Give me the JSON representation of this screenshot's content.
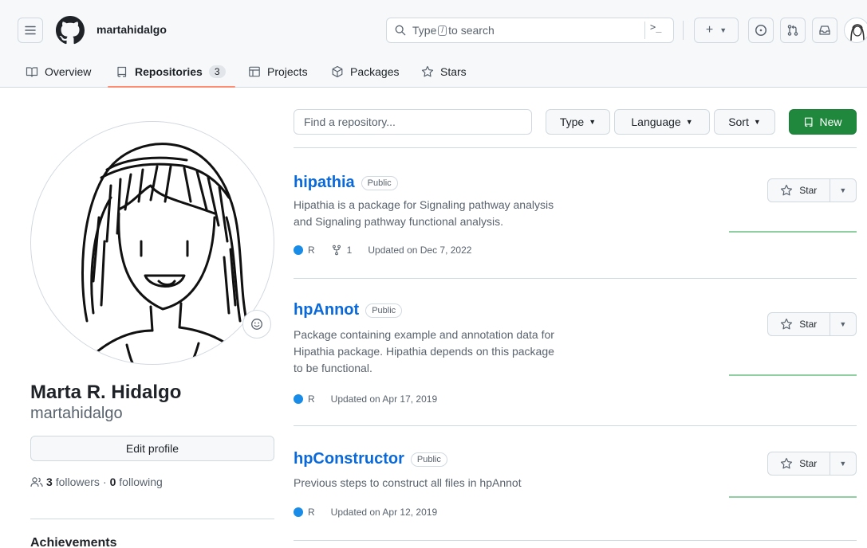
{
  "header": {
    "username": "martahidalgo",
    "search": {
      "prefix": "Type",
      "slash_key": "/",
      "suffix": "to search"
    },
    "command_symbol": ">_",
    "plus_symbol": "+"
  },
  "tabs": [
    {
      "label": "Overview",
      "icon": "book-icon"
    },
    {
      "label": "Repositories",
      "icon": "repo-icon",
      "count": "3",
      "active": true
    },
    {
      "label": "Projects",
      "icon": "table-icon"
    },
    {
      "label": "Packages",
      "icon": "package-icon"
    },
    {
      "label": "Stars",
      "icon": "star-icon"
    }
  ],
  "profile": {
    "full_name": "Marta R. Hidalgo",
    "login": "martahidalgo",
    "edit_profile_label": "Edit profile",
    "followers_count": "3",
    "followers_label": "followers",
    "dot_separator": "·",
    "following_count": "0",
    "following_label": "following",
    "achievements_label": "Achievements"
  },
  "repo_filters": {
    "find_placeholder": "Find a repository...",
    "type_label": "Type",
    "language_label": "Language",
    "sort_label": "Sort",
    "new_label": "New"
  },
  "repos": [
    {
      "name": "hipathia",
      "visibility": "Public",
      "description_lines": [
        "Hipathia is a package for Signaling pathway analysis",
        "and Signaling pathway functional analysis."
      ],
      "language": "R",
      "language_color": "#198ce7",
      "forks": "1",
      "updated": "Updated on Dec 7, 2022",
      "star_label": "Star"
    },
    {
      "name": "hpAnnot",
      "visibility": "Public",
      "description_lines": [
        "Package containing example and annotation data for",
        "Hipathia package. Hipathia depends on this package",
        "to be functional."
      ],
      "language": "R",
      "language_color": "#198ce7",
      "updated": "Updated on Apr 17, 2019",
      "star_label": "Star"
    },
    {
      "name": "hpConstructor",
      "visibility": "Public",
      "description_lines": [
        "Previous steps to construct all files in hpAnnot"
      ],
      "language": "R",
      "language_color": "#198ce7",
      "updated": "Updated on Apr 12, 2019",
      "star_label": "Star"
    }
  ],
  "colors": {
    "accent_link": "#0969da",
    "new_button": "#1f883d",
    "tab_underline": "#fd8c73",
    "sparkline": "#2da44e"
  }
}
